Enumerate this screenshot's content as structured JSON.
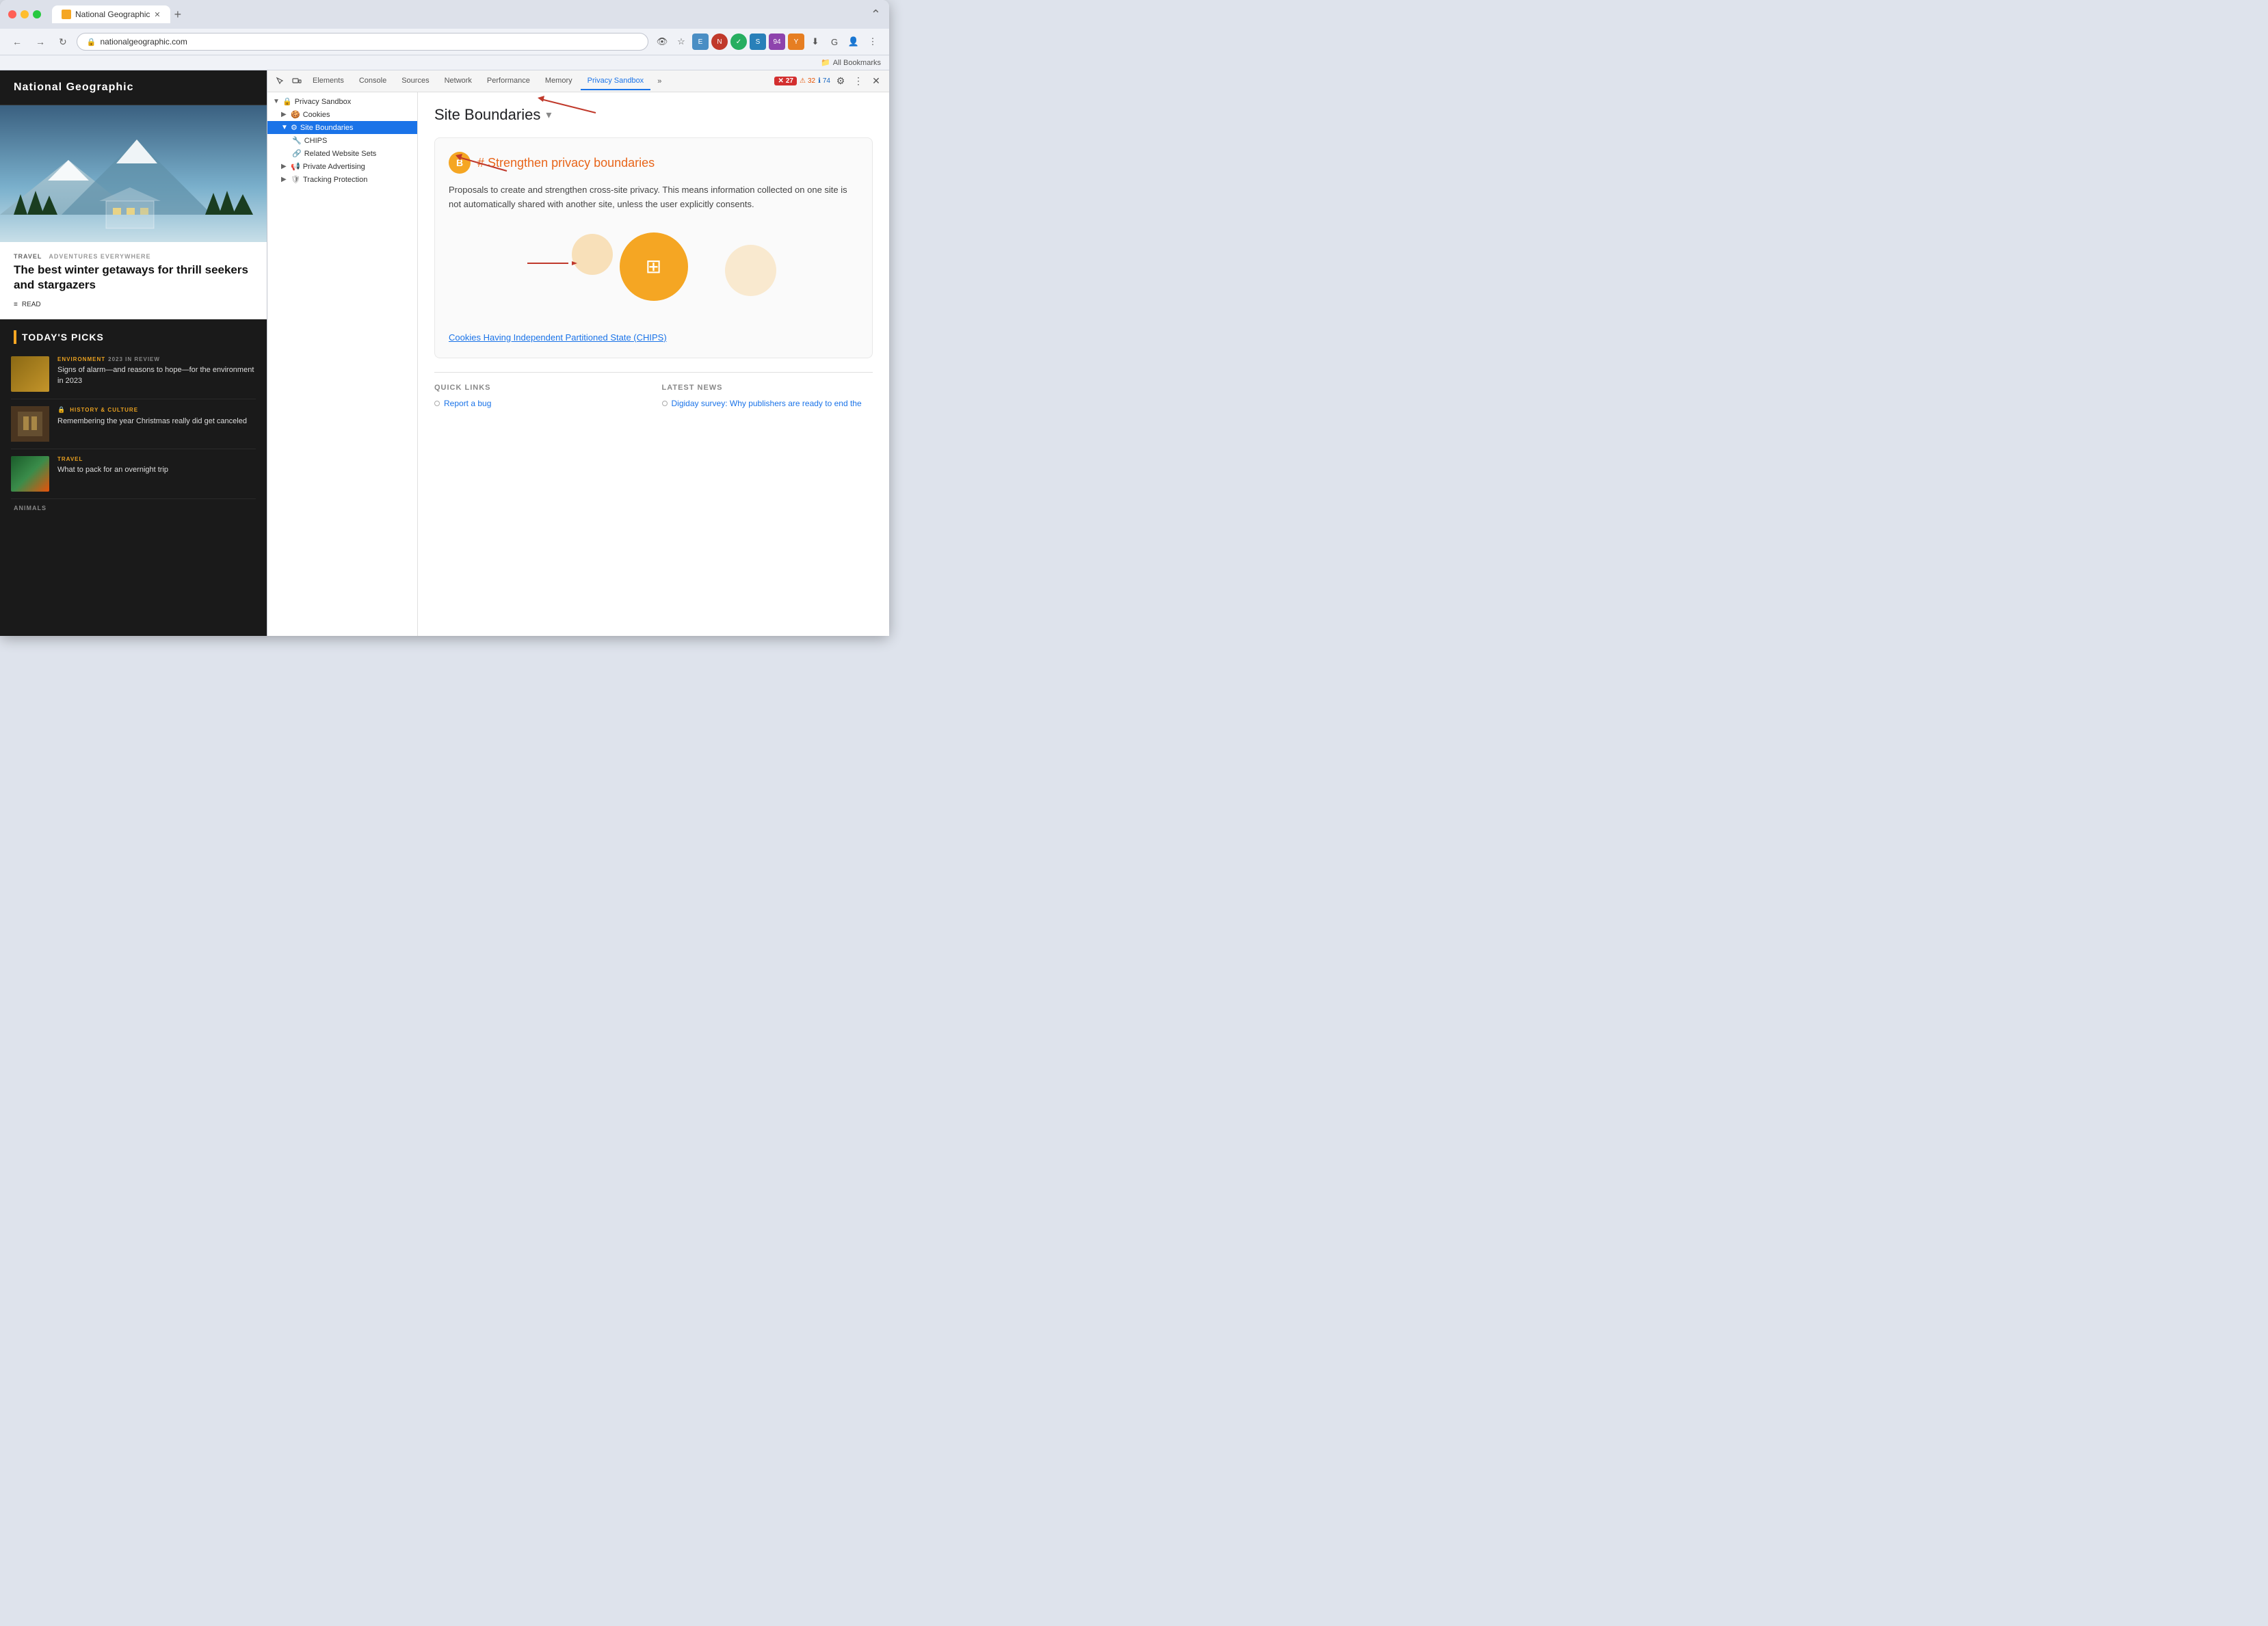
{
  "browser": {
    "tab_title": "National Geographic",
    "tab_favicon": "🌍",
    "address": "nationalgeographic.com",
    "bookmarks_label": "All Bookmarks",
    "new_tab_label": "+"
  },
  "devtools": {
    "tabs": [
      {
        "label": "Elements",
        "active": false
      },
      {
        "label": "Console",
        "active": false
      },
      {
        "label": "Sources",
        "active": false
      },
      {
        "label": "Network",
        "active": false
      },
      {
        "label": "Performance",
        "active": false
      },
      {
        "label": "Memory",
        "active": false
      },
      {
        "label": "Privacy Sandbox",
        "active": true
      }
    ],
    "more_tabs_label": "»",
    "error_count": "27",
    "warn_count": "32",
    "info_count": "74",
    "tree": {
      "items": [
        {
          "label": "Privacy Sandbox",
          "level": 0,
          "expanded": true,
          "icon": "🔒"
        },
        {
          "label": "Cookies",
          "level": 1,
          "expanded": false,
          "icon": "🍪"
        },
        {
          "label": "Site Boundaries",
          "level": 1,
          "expanded": true,
          "selected": true,
          "icon": "⚙"
        },
        {
          "label": "CHIPS",
          "level": 2,
          "icon": "🔧"
        },
        {
          "label": "Related Website Sets",
          "level": 2,
          "icon": "🔗"
        },
        {
          "label": "Private Advertising",
          "level": 1,
          "expanded": false,
          "icon": "📢"
        },
        {
          "label": "Tracking Protection",
          "level": 1,
          "expanded": false,
          "icon": "🛡"
        }
      ]
    },
    "content": {
      "page_title": "Site Boundaries",
      "card_icon_label": "B",
      "card_title": "Strengthen privacy boundaries",
      "card_body": "Proposals to create and strengthen cross-site privacy. This means information collected on one site is not automatically shared with another site, unless the user explicitly consents.",
      "chips_link": "Cookies Having Independent Partitioned State (CHIPS)",
      "quick_links_title": "QUICK LINKS",
      "latest_news_title": "LATEST NEWS",
      "quick_links": [
        {
          "label": "Report a bug"
        }
      ],
      "latest_news": [
        {
          "label": "Digiday survey: Why publishers are ready to end the"
        }
      ]
    }
  },
  "natgeo": {
    "logo": "National Geographic",
    "hero": {
      "category": "TRAVEL",
      "subcategory": "ADVENTURES EVERYWHERE",
      "title": "The best winter getaways for thrill seekers and stargazers",
      "read_label": "READ"
    },
    "section_title": "TODAY'S PICKS",
    "articles": [
      {
        "category": "ENVIRONMENT",
        "category_sub": "2023 IN REVIEW",
        "title": "Signs of alarm—and reasons to hope—for the environment in 2023",
        "thumb": "env"
      },
      {
        "category": "HISTORY & CULTURE",
        "category_sub": "",
        "title": "Remembering the year Christmas really did get canceled",
        "thumb": "hist"
      },
      {
        "category": "TRAVEL",
        "category_sub": "",
        "title": "What to pack for an overnight trip",
        "thumb": "travel"
      }
    ],
    "animals_label": "ANIMALS"
  }
}
